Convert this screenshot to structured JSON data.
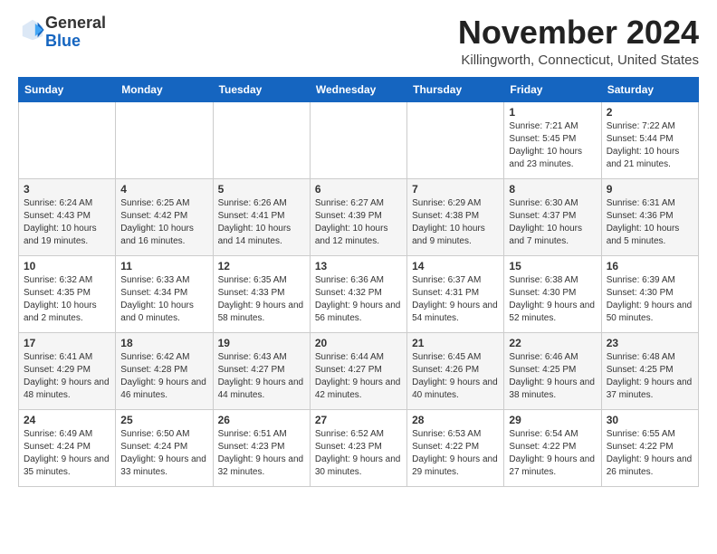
{
  "header": {
    "logo_general": "General",
    "logo_blue": "Blue",
    "month_title": "November 2024",
    "location": "Killingworth, Connecticut, United States"
  },
  "calendar": {
    "days_of_week": [
      "Sunday",
      "Monday",
      "Tuesday",
      "Wednesday",
      "Thursday",
      "Friday",
      "Saturday"
    ],
    "weeks": [
      [
        {
          "day": "",
          "info": ""
        },
        {
          "day": "",
          "info": ""
        },
        {
          "day": "",
          "info": ""
        },
        {
          "day": "",
          "info": ""
        },
        {
          "day": "",
          "info": ""
        },
        {
          "day": "1",
          "info": "Sunrise: 7:21 AM\nSunset: 5:45 PM\nDaylight: 10 hours and 23 minutes."
        },
        {
          "day": "2",
          "info": "Sunrise: 7:22 AM\nSunset: 5:44 PM\nDaylight: 10 hours and 21 minutes."
        }
      ],
      [
        {
          "day": "3",
          "info": "Sunrise: 6:24 AM\nSunset: 4:43 PM\nDaylight: 10 hours and 19 minutes."
        },
        {
          "day": "4",
          "info": "Sunrise: 6:25 AM\nSunset: 4:42 PM\nDaylight: 10 hours and 16 minutes."
        },
        {
          "day": "5",
          "info": "Sunrise: 6:26 AM\nSunset: 4:41 PM\nDaylight: 10 hours and 14 minutes."
        },
        {
          "day": "6",
          "info": "Sunrise: 6:27 AM\nSunset: 4:39 PM\nDaylight: 10 hours and 12 minutes."
        },
        {
          "day": "7",
          "info": "Sunrise: 6:29 AM\nSunset: 4:38 PM\nDaylight: 10 hours and 9 minutes."
        },
        {
          "day": "8",
          "info": "Sunrise: 6:30 AM\nSunset: 4:37 PM\nDaylight: 10 hours and 7 minutes."
        },
        {
          "day": "9",
          "info": "Sunrise: 6:31 AM\nSunset: 4:36 PM\nDaylight: 10 hours and 5 minutes."
        }
      ],
      [
        {
          "day": "10",
          "info": "Sunrise: 6:32 AM\nSunset: 4:35 PM\nDaylight: 10 hours and 2 minutes."
        },
        {
          "day": "11",
          "info": "Sunrise: 6:33 AM\nSunset: 4:34 PM\nDaylight: 10 hours and 0 minutes."
        },
        {
          "day": "12",
          "info": "Sunrise: 6:35 AM\nSunset: 4:33 PM\nDaylight: 9 hours and 58 minutes."
        },
        {
          "day": "13",
          "info": "Sunrise: 6:36 AM\nSunset: 4:32 PM\nDaylight: 9 hours and 56 minutes."
        },
        {
          "day": "14",
          "info": "Sunrise: 6:37 AM\nSunset: 4:31 PM\nDaylight: 9 hours and 54 minutes."
        },
        {
          "day": "15",
          "info": "Sunrise: 6:38 AM\nSunset: 4:30 PM\nDaylight: 9 hours and 52 minutes."
        },
        {
          "day": "16",
          "info": "Sunrise: 6:39 AM\nSunset: 4:30 PM\nDaylight: 9 hours and 50 minutes."
        }
      ],
      [
        {
          "day": "17",
          "info": "Sunrise: 6:41 AM\nSunset: 4:29 PM\nDaylight: 9 hours and 48 minutes."
        },
        {
          "day": "18",
          "info": "Sunrise: 6:42 AM\nSunset: 4:28 PM\nDaylight: 9 hours and 46 minutes."
        },
        {
          "day": "19",
          "info": "Sunrise: 6:43 AM\nSunset: 4:27 PM\nDaylight: 9 hours and 44 minutes."
        },
        {
          "day": "20",
          "info": "Sunrise: 6:44 AM\nSunset: 4:27 PM\nDaylight: 9 hours and 42 minutes."
        },
        {
          "day": "21",
          "info": "Sunrise: 6:45 AM\nSunset: 4:26 PM\nDaylight: 9 hours and 40 minutes."
        },
        {
          "day": "22",
          "info": "Sunrise: 6:46 AM\nSunset: 4:25 PM\nDaylight: 9 hours and 38 minutes."
        },
        {
          "day": "23",
          "info": "Sunrise: 6:48 AM\nSunset: 4:25 PM\nDaylight: 9 hours and 37 minutes."
        }
      ],
      [
        {
          "day": "24",
          "info": "Sunrise: 6:49 AM\nSunset: 4:24 PM\nDaylight: 9 hours and 35 minutes."
        },
        {
          "day": "25",
          "info": "Sunrise: 6:50 AM\nSunset: 4:24 PM\nDaylight: 9 hours and 33 minutes."
        },
        {
          "day": "26",
          "info": "Sunrise: 6:51 AM\nSunset: 4:23 PM\nDaylight: 9 hours and 32 minutes."
        },
        {
          "day": "27",
          "info": "Sunrise: 6:52 AM\nSunset: 4:23 PM\nDaylight: 9 hours and 30 minutes."
        },
        {
          "day": "28",
          "info": "Sunrise: 6:53 AM\nSunset: 4:22 PM\nDaylight: 9 hours and 29 minutes."
        },
        {
          "day": "29",
          "info": "Sunrise: 6:54 AM\nSunset: 4:22 PM\nDaylight: 9 hours and 27 minutes."
        },
        {
          "day": "30",
          "info": "Sunrise: 6:55 AM\nSunset: 4:22 PM\nDaylight: 9 hours and 26 minutes."
        }
      ]
    ]
  }
}
